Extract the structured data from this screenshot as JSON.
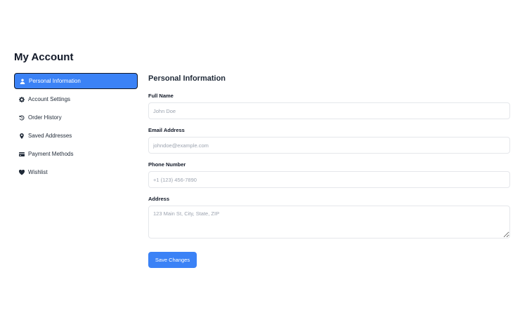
{
  "page": {
    "title": "My Account"
  },
  "sidebar": {
    "items": [
      {
        "label": "Personal Information",
        "icon": "user-icon",
        "active": true
      },
      {
        "label": "Account Settings",
        "icon": "gear-icon",
        "active": false
      },
      {
        "label": "Order History",
        "icon": "history-icon",
        "active": false
      },
      {
        "label": "Saved Addresses",
        "icon": "map-pin-icon",
        "active": false
      },
      {
        "label": "Payment Methods",
        "icon": "credit-card-icon",
        "active": false
      },
      {
        "label": "Wishlist",
        "icon": "heart-icon",
        "active": false
      }
    ]
  },
  "form": {
    "title": "Personal Information",
    "full_name": {
      "label": "Full Name",
      "placeholder": "John Doe",
      "value": ""
    },
    "email": {
      "label": "Email Address",
      "placeholder": "johndoe@example.com",
      "value": ""
    },
    "phone": {
      "label": "Phone Number",
      "placeholder": "+1 (123) 456-7890",
      "value": ""
    },
    "address": {
      "label": "Address",
      "placeholder": "123 Main St, City, State, ZIP",
      "value": ""
    },
    "save_label": "Save Changes"
  },
  "colors": {
    "accent": "#3b82f6",
    "border": "#e5e7eb",
    "placeholder": "#9ca3af",
    "text": "#111827"
  }
}
